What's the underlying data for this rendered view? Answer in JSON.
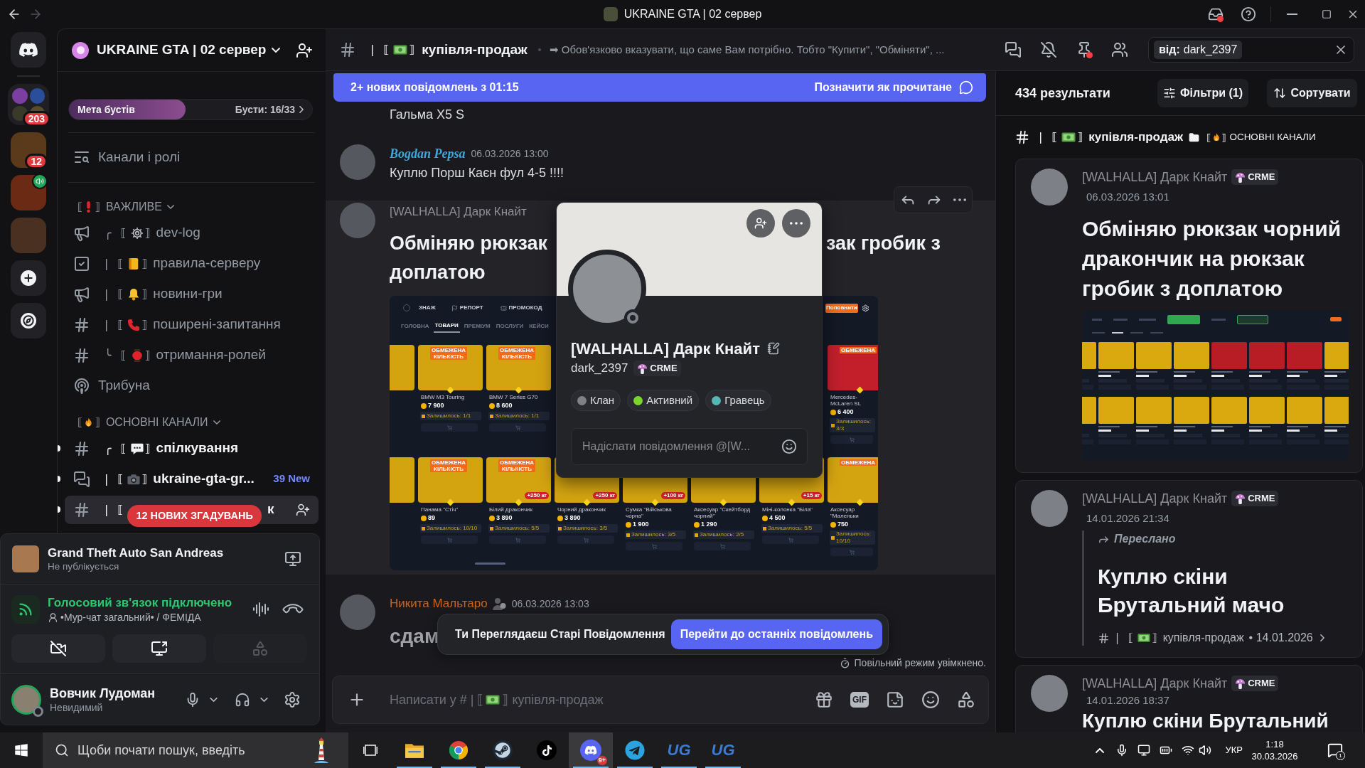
{
  "window": {
    "title": "UKRAINE GTA | 02 сервер",
    "back_enabled": true,
    "forward_enabled": false,
    "inbox_unread": true
  },
  "servers": [
    {
      "kind": "folder",
      "badge": "203",
      "voice": false
    },
    {
      "kind": "server",
      "badge": "12",
      "voice": false
    },
    {
      "kind": "server",
      "voice": true
    },
    {
      "kind": "server",
      "voice": false
    }
  ],
  "sidebar": {
    "server_name": "UKRAINE GTA | 02 сервер",
    "boost": {
      "label": "Мета бустів",
      "count": "Бусти: 16/33",
      "level": 0.48
    },
    "browse": "Канали і ролі",
    "categories": [
      {
        "prefix": "⟦",
        "emoji": {
          "kind": "exclamation"
        },
        "suffix": "⟧",
        "name": "ВАЖЛИВЕ",
        "expanded": true,
        "channels": [
          {
            "kind": "announcement",
            "prefix": "╭ ⟦",
            "emoji": {
              "kind": "gear"
            },
            "suffix": "⟧",
            "name": "dev-log",
            "unread": false,
            "selected": false
          },
          {
            "kind": "rules",
            "prefix": "| ⟦",
            "emoji": {
              "kind": "notebook"
            },
            "suffix": "⟧",
            "name": "правила-серверу",
            "unread": false,
            "selected": false
          },
          {
            "kind": "announcement",
            "prefix": "| ⟦",
            "emoji": {
              "kind": "bell"
            },
            "suffix": "⟧",
            "name": "новини-гри",
            "unread": false,
            "selected": false
          },
          {
            "kind": "text",
            "prefix": "| ⟦",
            "emoji": {
              "kind": "phone"
            },
            "suffix": "⟧",
            "name": "поширені-запитання",
            "unread": false,
            "selected": false
          },
          {
            "kind": "text",
            "prefix": "╰ ⟦",
            "emoji": {
              "kind": "lantern"
            },
            "suffix": "⟧",
            "name": "отримання-ролей",
            "unread": false,
            "selected": false
          },
          {
            "kind": "stage",
            "name": "Трибуна",
            "unread": false,
            "selected": false
          }
        ]
      },
      {
        "prefix": "⟦",
        "emoji": {
          "kind": "fire"
        },
        "suffix": "⟧",
        "name": "ОСНОВНІ КАНАЛИ",
        "expanded": true,
        "channels": [
          {
            "kind": "text",
            "prefix": "╭ ⟦",
            "emoji": {
              "kind": "speech"
            },
            "suffix": "⟧",
            "name": "спілкування",
            "unread": true,
            "selected": false
          },
          {
            "kind": "forum",
            "prefix": "| ⟦",
            "emoji": {
              "kind": "camera"
            },
            "suffix": "⟧",
            "name": "ukraine-gta-gr...",
            "new": "39 New",
            "unread": true,
            "selected": false
          },
          {
            "kind": "text",
            "prefix": "| ⟦",
            "mentions": "12 НОВИХ ЗГАДУВАНЬ",
            "name": "к",
            "unread": true,
            "selected": true
          }
        ]
      }
    ]
  },
  "user_panel": {
    "game": "Grand Theft Auto San Andreas",
    "game_status": "Не публікується",
    "voice_status": "Голосовий зв'язок підключено",
    "voice_channel": "•Мур-чат загальний• / ФЕМІДА",
    "camera_on": false,
    "activities_enabled": false,
    "user": "Вовчик Лудоман",
    "online": false,
    "user_status": "Невидимий",
    "speaking": true
  },
  "chat": {
    "header": {
      "prefix": "| ⟦",
      "emoji": {
        "kind": "money"
      },
      "suffix": "⟧",
      "name": "купівля-продаж",
      "topic": "➡ Обов'язково вказувати, що саме Вам потрібно. Тобто \"Купити\", \"Обміняти\", ...",
      "new_pins": true,
      "search_filter": "від:",
      "search_value": "dark_2397"
    },
    "new_bar": {
      "text": "2+ нових повідомлень з 01:15",
      "action": "Позначити як прочитане"
    },
    "messages": [
      {
        "kind": "continuation",
        "text": "Гальма X5 S",
        "hovered": false
      },
      {
        "kind": "plain",
        "author": "Bogdan Pepsa",
        "color": "#3fa7d9",
        "fancy_name": true,
        "role_icon": false,
        "time": "06.03.2026 13:00",
        "text": "Куплю Порш Каєн фул 4-5 !!!!",
        "hovered": false
      },
      {
        "kind": "covered",
        "author": "[WALHALLA] Дарк Кнайт",
        "color": "#8f9096",
        "fancy_name": false,
        "role_icon": false,
        "text_parts": [
          "Обміняю рюкзак",
          "зак гробик з",
          "доплатою"
        ],
        "hovered": true,
        "attachment": {
          "nav": [
            {
              "kind": "plain",
              "label": "ЗНАЖ"
            },
            {
              "kind": "flag",
              "label": "РЕПОРТ"
            },
            {
              "kind": "ticket",
              "label": "ПРОМОКОД"
            }
          ],
          "top_up": "Поповнити",
          "tabs": [
            {
              "label": "ГОЛОВНА",
              "selected": false
            },
            {
              "label": "ТОВАРИ",
              "selected": true
            },
            {
              "label": "ПРЕМІУМ",
              "selected": false
            },
            {
              "label": "ПОСЛУГИ",
              "selected": false
            },
            {
              "label": "КЕЙСИ",
              "selected": false
            }
          ],
          "rows": [
            [
              {
                "kind": "partial",
                "color": "#d4a410"
              },
              {
                "kind": "full",
                "color": "#d4a410",
                "tag": "ОБМЕЖЕНА КІЛЬКІСТЬ",
                "name": "BMW M3 Touring",
                "price": "7 900",
                "stock": "Залишилось: 1/1"
              },
              {
                "kind": "full",
                "color": "#d4a410",
                "tag": "ОБМЕЖЕНА КІЛЬКІСТЬ",
                "name": "BMW 7 Series G70",
                "price": "8 600",
                "stock": "Залишилось: 1/1"
              },
              {
                "kind": "hidden"
              },
              {
                "kind": "hidden"
              },
              {
                "kind": "hidden"
              },
              {
                "kind": "hidden"
              },
              {
                "kind": "full",
                "color": "#c21f2b",
                "tag": "ОБМЕЖЕНА",
                "name": "Mercedes-McLaren SL",
                "price": "6 400",
                "stock": "Залишилось: 3/3"
              }
            ],
            [
              {
                "kind": "partial",
                "color": "#d4a410"
              },
              {
                "kind": "full",
                "color": "#d4a410",
                "tag": "ОБМЕЖЕНА КІЛЬКІСТЬ",
                "name": "Панама \"Стіч\"",
                "price": "89",
                "stock": "Залишилось: 10/10"
              },
              {
                "kind": "full",
                "color": "#d4a410",
                "tag": "ОБМЕЖЕНА КІЛЬКІСТЬ",
                "weight": "+250 кг",
                "name": "Білий дракончик",
                "price": "3 890",
                "stock": "Залишилось: 5/5"
              },
              {
                "kind": "full",
                "color": "#d4a410",
                "weight": "+250 кг",
                "name": "Чорний дракончик",
                "price": "3 890",
                "stock": "Залишилось: 3/5"
              },
              {
                "kind": "full",
                "color": "#d4a410",
                "weight": "+100 кг",
                "name": "Сумка \"Військова чорна\"",
                "price": "1 900",
                "stock": "Залишилось: 3/5"
              },
              {
                "kind": "full",
                "color": "#d4a410",
                "name": "Аксесуар \"Скейтборд чорний\"",
                "price": "1 290",
                "stock": "Залишилось: 2/5"
              },
              {
                "kind": "full",
                "color": "#d4a410",
                "weight": "+15 кг",
                "name": "Міні-колонка \"Біла\"",
                "price": "4 500",
                "stock": "Залишилось: 5/5"
              },
              {
                "kind": "full",
                "color": "#d4a410",
                "tag": "ОБМЕЖЕНА",
                "name": "Аксесуар \"Маленьки",
                "price": "750",
                "stock": "Залишилось: 10/10"
              }
            ]
          ]
        }
      },
      {
        "kind": "jumbo",
        "author": "Никита Мальтаро",
        "color": "#c8641f",
        "fancy_name": false,
        "role_icon": true,
        "time": "06.03.2026 13:03",
        "text": "сдам",
        "hovered": false
      }
    ],
    "profile": {
      "name": "[WALHALLA] Дарк Кнайт",
      "username": "dark_2397",
      "tag": "CRME",
      "online": false,
      "roles": [
        {
          "name": "Клан",
          "color": "#808086"
        },
        {
          "name": "Активний",
          "color": "#7bd62a"
        },
        {
          "name": "Гравець",
          "color": "#55b6b4"
        }
      ],
      "placeholder": "Надіслати повідомлення @[W..."
    },
    "old_bar": {
      "text": "Ти Переглядаєш Старі Повідомлення",
      "action": "Перейти до останніх повідомлень"
    },
    "slow_mode": "Повільний режим увімкнено.",
    "composer": {
      "placeholder_start": "Написати у # | ⟦",
      "emoji": {
        "kind": "money"
      },
      "placeholder_end": "⟧ купівля-продаж",
      "gif": "GIF"
    }
  },
  "results": {
    "count": "434 результати",
    "filters": "Фільтри (1)",
    "sort": "Сортувати",
    "channel": {
      "prefix": "| ⟦",
      "emoji": {
        "kind": "money"
      },
      "suffix": "⟧",
      "name": "купівля-продаж",
      "category_prefix": "⟦",
      "category_emoji": {
        "kind": "fire"
      },
      "category_suffix": "⟧",
      "category": "ОСНОВНІ КАНАЛИ"
    },
    "items": [
      {
        "author": "[WALHALLA] Дарк Кнайт",
        "tag": "CRME",
        "time": "06.03.2026 13:01",
        "forwarded": false,
        "text": "Обміняю рюкзак чорний дракончик на рюкзак гробик з доплатою",
        "attachment": true
      },
      {
        "author": "[WALHALLA] Дарк Кнайт",
        "tag": "CRME",
        "time": "14.01.2026 21:34",
        "forwarded": true,
        "forward_label": "Переслано",
        "text": "Куплю скіни Брутальний мачо",
        "attachment": false,
        "source": {
          "prefix": "| ⟦",
          "emoji": {
            "kind": "money"
          },
          "suffix": "⟧",
          "channel": "купівля-продаж",
          "date": "• 14.01.2026"
        }
      },
      {
        "author": "[WALHALLA] Дарк Кнайт",
        "tag": "CRME",
        "time": "14.01.2026 18:37",
        "forwarded": false,
        "text": "Куплю скіни Брутальний",
        "attachment": false
      }
    ]
  },
  "taskbar": {
    "search": "Щоби почати пошук, введіть",
    "apps": [
      {
        "kind": "explorer",
        "open": true,
        "selected": false
      },
      {
        "kind": "chrome",
        "open": true,
        "selected": false
      },
      {
        "kind": "steam",
        "open": true,
        "selected": false
      },
      {
        "kind": "tiktok",
        "open": false,
        "selected": false
      },
      {
        "kind": "discord",
        "open": true,
        "selected": true,
        "badge": "9+"
      },
      {
        "kind": "telegram",
        "open": true,
        "selected": false
      },
      {
        "kind": "ug",
        "label": "UG",
        "open": true,
        "selected": false
      },
      {
        "kind": "ug",
        "label": "UG",
        "open": true,
        "selected": false
      }
    ],
    "language": "УКР",
    "time": "1:18",
    "date": "30.03.2026",
    "notifications": "1"
  }
}
